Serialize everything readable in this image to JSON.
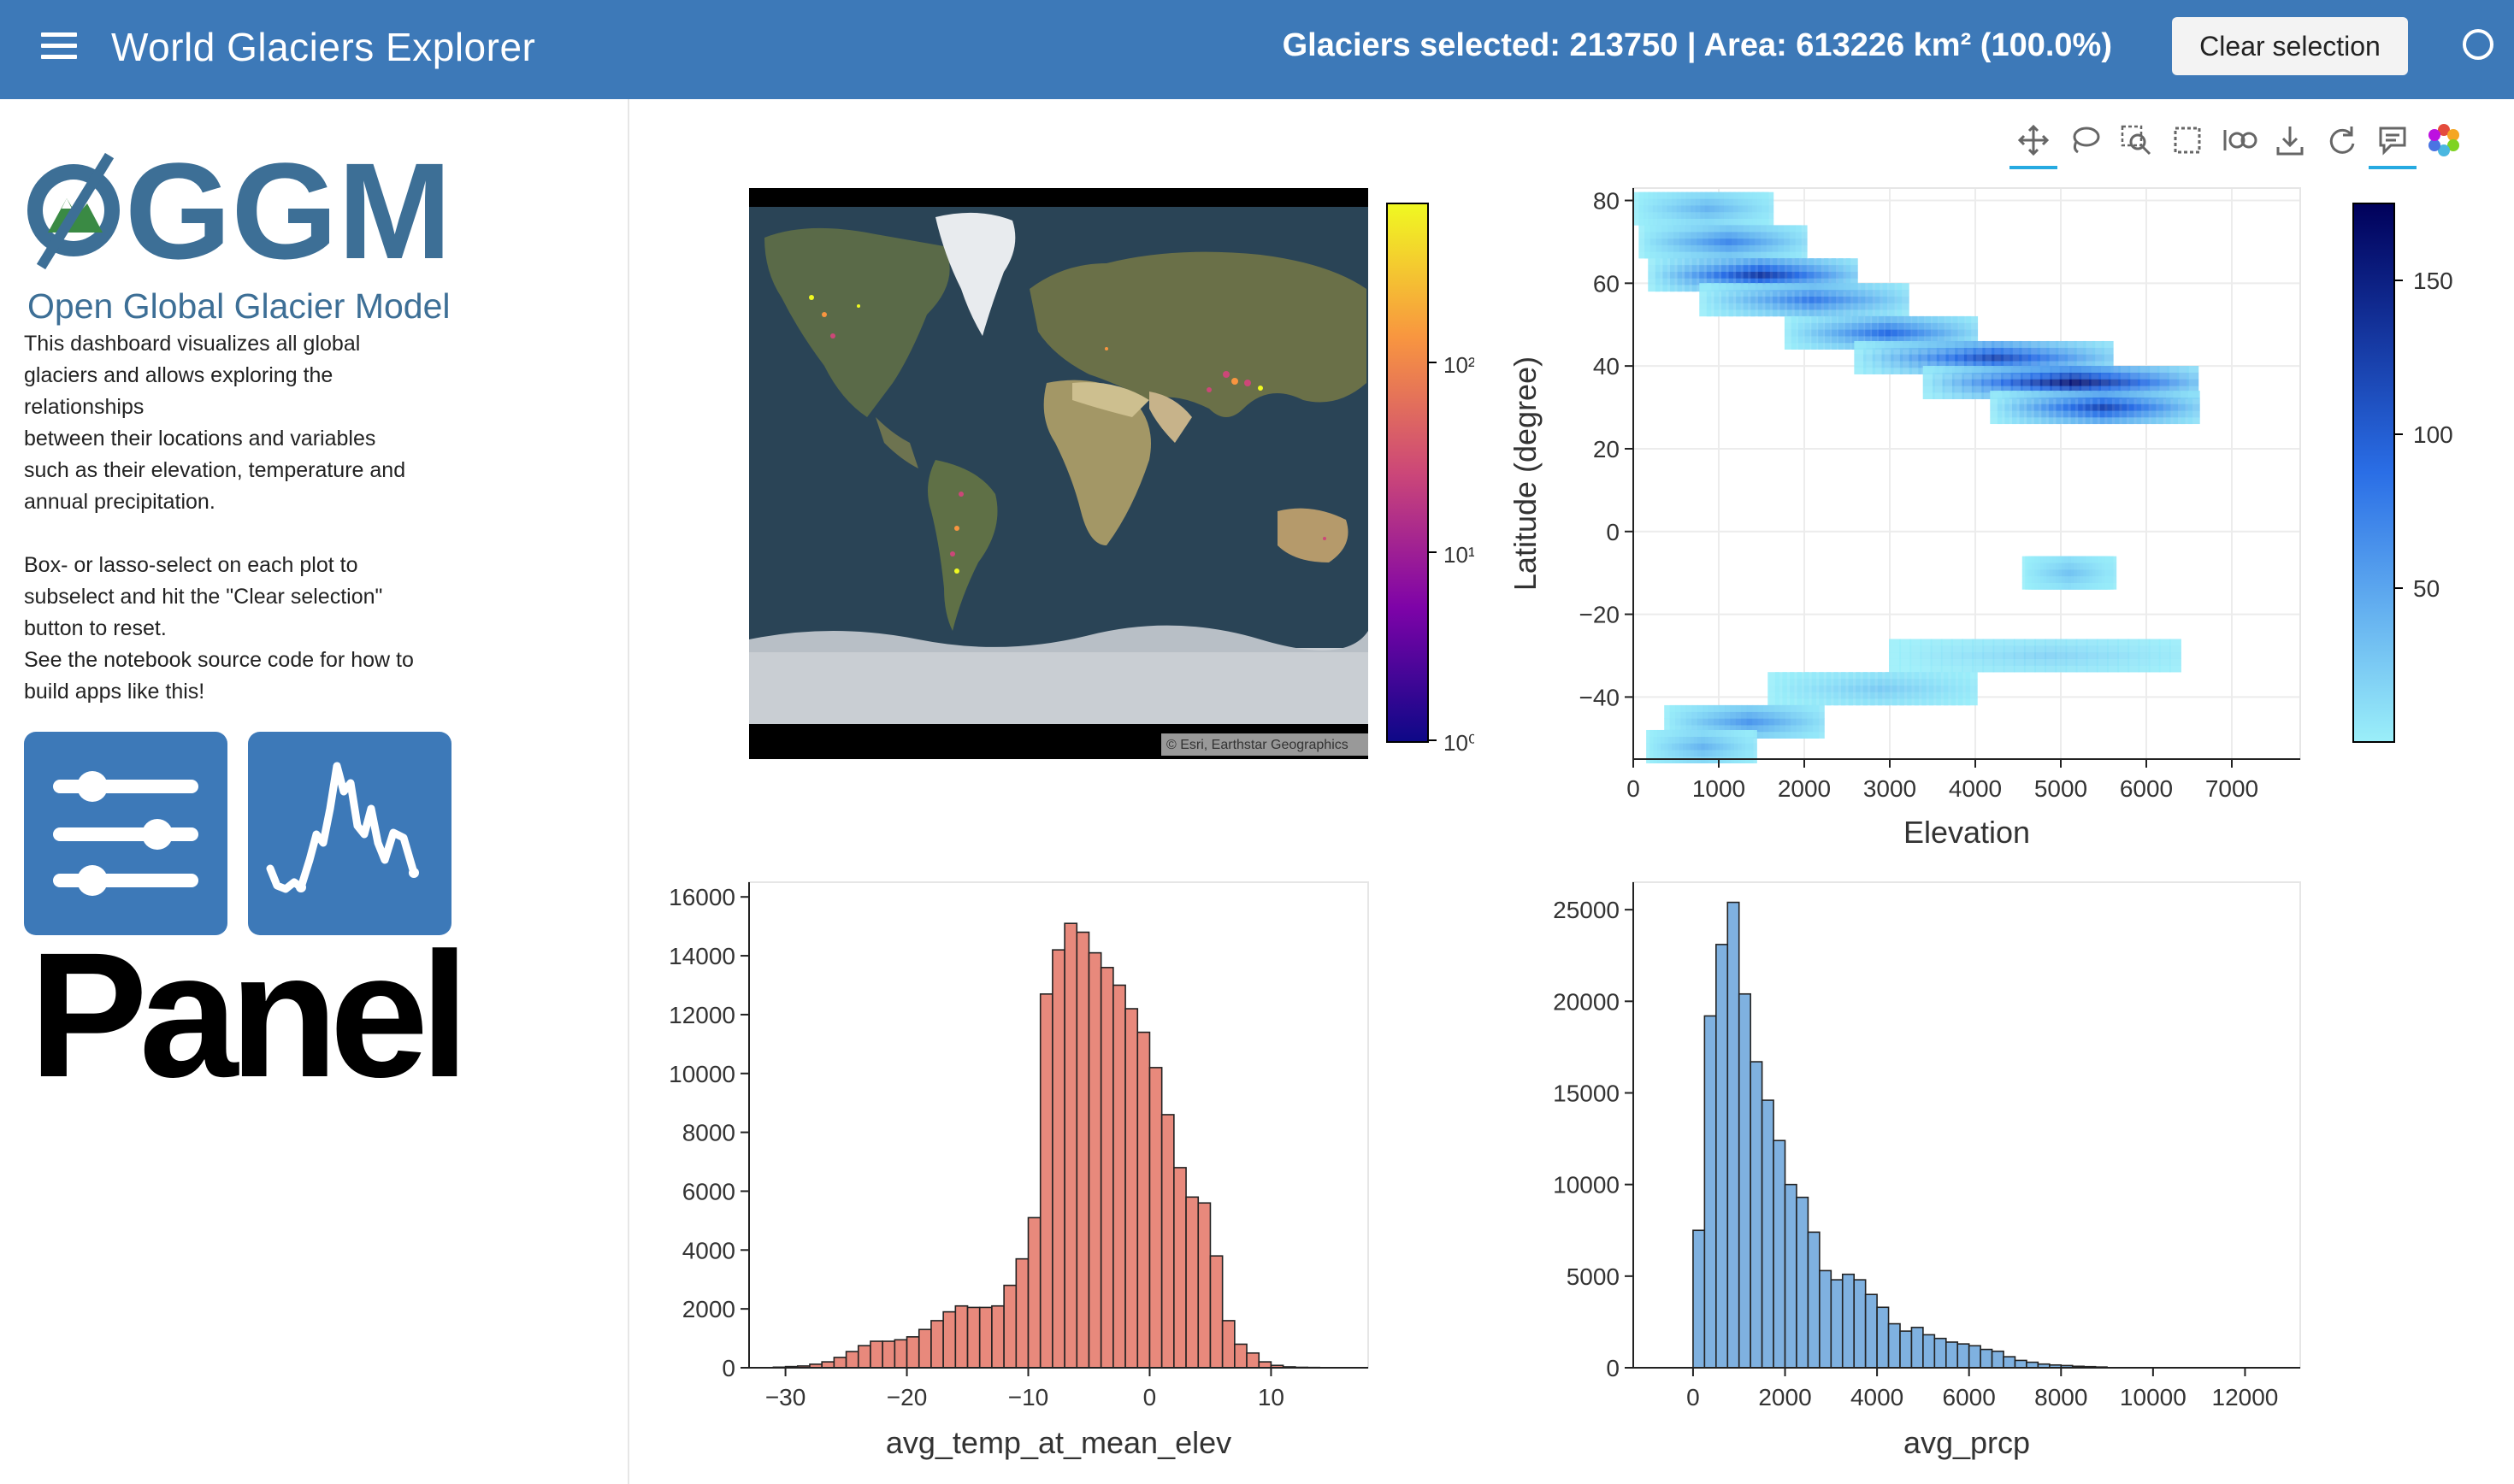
{
  "header": {
    "title": "World Glaciers Explorer",
    "status": "Glaciers selected: 213750 | Area: 613226 km² (100.0%)",
    "clear_button": "Clear selection",
    "menu_icon": "hamburger-menu-icon",
    "busy_icon": "busy-indicator-icon"
  },
  "sidebar": {
    "logo_text": "GGM",
    "logo_subtitle": "Open Global Glacier Model",
    "description_1": "This dashboard visualizes all global\nglaciers and allows exploring the\nrelationships\nbetween their locations and variables\nsuch as their elevation, temperature and\nannual precipitation.",
    "description_2": "Box- or lasso-select on each plot to\nsubselect and hit the \"Clear selection\"\nbutton to reset.\nSee the notebook source code for how to\nbuild apps like this!",
    "panel_word": "Panel"
  },
  "toolbar": {
    "tools": [
      "pan-icon",
      "lasso-select-icon",
      "box-zoom-icon",
      "box-select-icon",
      "link-icon",
      "save-icon",
      "reset-icon",
      "hover-icon",
      "bokeh-logo-icon"
    ]
  },
  "colors": {
    "header_bg": "#3d79b8",
    "temp_bar": "#e8897c",
    "prcp_bar": "#7fb1e0",
    "hex_light": "#9beff9",
    "hex_dark": "#00005a"
  },
  "map": {
    "attribution": "© Esri, Earthstar Geographics",
    "colorbar_ticks": [
      "10²",
      "10¹",
      "10⁰"
    ]
  },
  "chart_data": [
    {
      "type": "heatmap",
      "xlabel": "Elevation",
      "ylabel": "Latitude (degree)",
      "xlim": [
        0,
        7800
      ],
      "ylim": [
        -55,
        83
      ],
      "xticks": [
        0,
        1000,
        2000,
        3000,
        4000,
        5000,
        6000,
        7000
      ],
      "yticks": [
        80,
        60,
        40,
        20,
        0,
        -20,
        -40
      ],
      "xtick_labels": [
        "0",
        "1000",
        "2000",
        "3000",
        "4000",
        "5000",
        "6000",
        "7000"
      ],
      "ytick_labels": [
        "80",
        "60",
        "40",
        "20",
        "0",
        "−20",
        "−40"
      ],
      "colorbar_ticks": [
        150,
        100,
        50
      ],
      "colorbar_range": [
        0,
        175
      ],
      "density_bands": [
        {
          "lat": 78,
          "e_min": 50,
          "e_max": 1600,
          "peak": 40
        },
        {
          "lat": 70,
          "e_min": 100,
          "e_max": 2000,
          "peak": 70
        },
        {
          "lat": 62,
          "e_min": 200,
          "e_max": 2600,
          "peak": 130
        },
        {
          "lat": 56,
          "e_min": 800,
          "e_max": 3200,
          "peak": 80
        },
        {
          "lat": 48,
          "e_min": 1800,
          "e_max": 4000,
          "peak": 90
        },
        {
          "lat": 42,
          "e_min": 2600,
          "e_max": 5600,
          "peak": 120
        },
        {
          "lat": 36,
          "e_min": 3400,
          "e_max": 6600,
          "peak": 160
        },
        {
          "lat": 30,
          "e_min": 4200,
          "e_max": 6600,
          "peak": 120
        },
        {
          "lat": -10,
          "e_min": 4600,
          "e_max": 5600,
          "peak": 30
        },
        {
          "lat": -30,
          "e_min": 3000,
          "e_max": 6400,
          "peak": 20
        },
        {
          "lat": -38,
          "e_min": 1600,
          "e_max": 4000,
          "peak": 25
        },
        {
          "lat": -46,
          "e_min": 400,
          "e_max": 2200,
          "peak": 60
        },
        {
          "lat": -52,
          "e_min": 200,
          "e_max": 1400,
          "peak": 40
        }
      ]
    },
    {
      "type": "bar",
      "xlabel": "avg_temp_at_mean_elev",
      "ylabel": "",
      "bin_width": 1,
      "x_start": -31,
      "xlim": [
        -33,
        18
      ],
      "ylim": [
        0,
        16500
      ],
      "xticks": [
        -30,
        -20,
        -10,
        0,
        10
      ],
      "xtick_labels": [
        "−30",
        "−20",
        "−10",
        "0",
        "10"
      ],
      "yticks": [
        0,
        2000,
        4000,
        6000,
        8000,
        10000,
        12000,
        14000,
        16000
      ],
      "values": [
        20,
        40,
        60,
        120,
        200,
        350,
        550,
        750,
        900,
        900,
        950,
        1050,
        1300,
        1600,
        1900,
        2100,
        2050,
        2050,
        2100,
        2800,
        3700,
        5100,
        12700,
        14200,
        15100,
        14800,
        14100,
        13600,
        13000,
        12200,
        11400,
        10200,
        8600,
        6800,
        5800,
        5600,
        3800,
        1600,
        800,
        500,
        200,
        80,
        30,
        15,
        10
      ]
    },
    {
      "type": "bar",
      "xlabel": "avg_prcp",
      "ylabel": "",
      "bin_width": 250,
      "x_start": 0,
      "xlim": [
        -1300,
        13200
      ],
      "ylim": [
        0,
        26500
      ],
      "xticks": [
        0,
        2000,
        4000,
        6000,
        8000,
        10000,
        12000
      ],
      "xtick_labels": [
        "0",
        "2000",
        "4000",
        "6000",
        "8000",
        "10000",
        "12000"
      ],
      "yticks": [
        0,
        5000,
        10000,
        15000,
        20000,
        25000
      ],
      "values": [
        7500,
        19200,
        23100,
        25400,
        20400,
        16700,
        14600,
        12400,
        10000,
        9300,
        7400,
        5300,
        4800,
        5100,
        4800,
        4000,
        3300,
        2400,
        2000,
        2200,
        1800,
        1600,
        1400,
        1300,
        1200,
        1000,
        900,
        600,
        400,
        300,
        200,
        150,
        120,
        80,
        60,
        40
      ]
    }
  ]
}
